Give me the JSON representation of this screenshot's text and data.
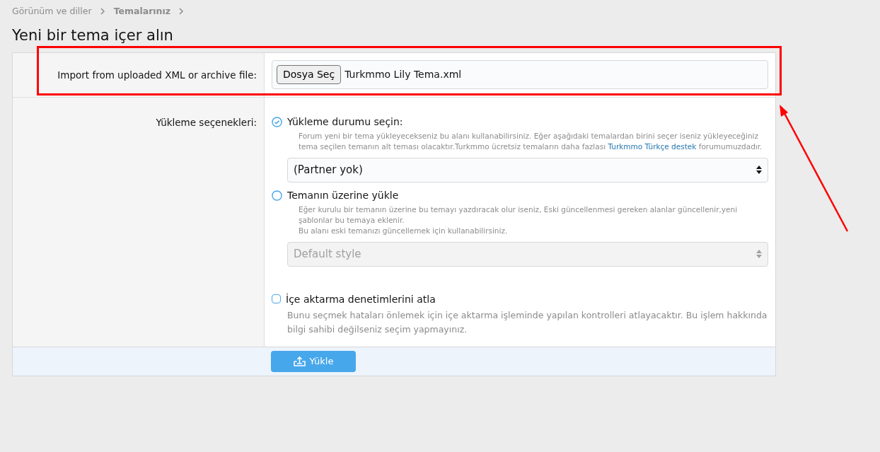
{
  "breadcrumb": [
    {
      "label": "Görünüm ve diller",
      "current": false
    },
    {
      "label": "Temalarınız",
      "current": true
    }
  ],
  "title": "Yeni bir tema içer alın",
  "import_row": {
    "label": "Import from uploaded XML or archive file:",
    "button": "Dosya Seç",
    "file_name": "Turkmmo Lily Tema.xml"
  },
  "options_row": {
    "label": "Yükleme seçenekleri:",
    "radios": [
      {
        "label": "Yükleme durumu seçin:",
        "selected": true,
        "description": [
          {
            "before": "Forum yeni bir tema yükleyecekseniz bu alanı kullanabilirsiniz. Eğer aşağıdaki temalardan birini seçer iseniz yükleyeceğiniz tema seçilen temanın alt teması olacaktır.Turkmmo ücretsiz temaların daha fazlası ",
            "link": "Turkmmo Türkçe destek",
            "after": " forumumuzdadır."
          }
        ],
        "select": {
          "value": "(Partner yok)",
          "disabled": false
        }
      },
      {
        "label": "Temanın üzerine yükle",
        "selected": false,
        "description": [
          {
            "before": "Eğer kurulu bir temanın üzerine bu temayı yazdıracak olur iseniz, Eski güncellenmesi gereken alanlar güncellenir,yeni şablonlar bu temaya eklenir."
          },
          {
            "before": "Bu alanı eski temanızı güncellemek için kullanabilirsiniz."
          }
        ],
        "select": {
          "value": "Default style",
          "disabled": true
        }
      }
    ],
    "checkbox": {
      "label": "İçe aktarma denetimlerini atla",
      "checked": false,
      "description": "Bunu seçmek hataları önlemek için içe aktarma işleminde yapılan kontrolleri atlayacaktır. Bu işlem hakkında bilgi sahibi değilseniz seçim yapmayınız."
    }
  },
  "submit": "Yükle"
}
